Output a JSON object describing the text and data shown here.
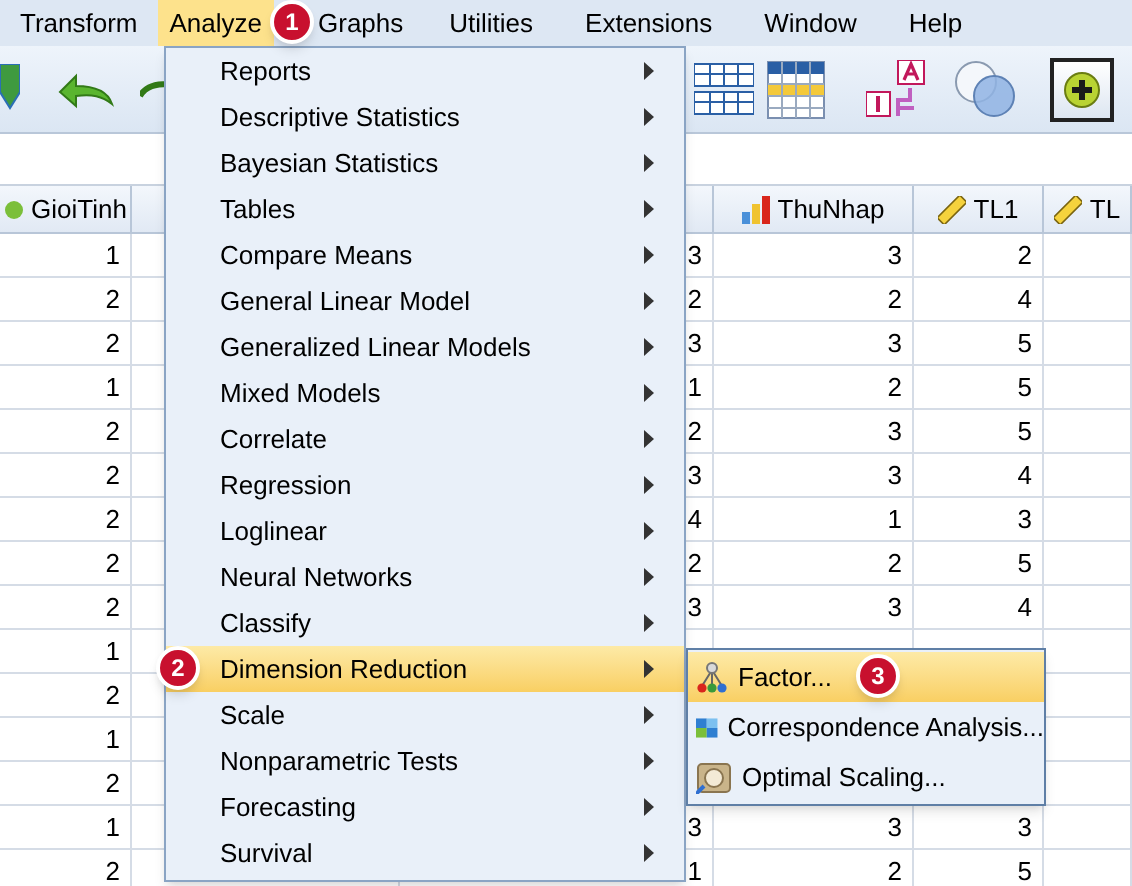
{
  "menubar": [
    {
      "label": "Transform",
      "selected": false
    },
    {
      "label": "Analyze",
      "selected": true,
      "badge": "1"
    },
    {
      "label": "Graphs",
      "selected": false
    },
    {
      "label": "Utilities",
      "selected": false
    },
    {
      "label": "Extensions",
      "selected": false
    },
    {
      "label": "Window",
      "selected": false
    },
    {
      "label": "Help",
      "selected": false
    }
  ],
  "grid": {
    "columns": [
      {
        "header": "GioiTinh",
        "kind": "nominal"
      },
      {
        "kind": "blank"
      },
      {
        "kind": "blank"
      },
      {
        "header": "ThuNhap",
        "kind": "ordinal"
      },
      {
        "header": "TL1",
        "kind": "scale"
      },
      {
        "header": "TL",
        "kind": "scale"
      }
    ],
    "rows": [
      [
        "1",
        null,
        "3",
        "3",
        "2",
        null
      ],
      [
        "2",
        null,
        "2",
        "2",
        "4",
        null
      ],
      [
        "2",
        null,
        "3",
        "3",
        "5",
        null
      ],
      [
        "1",
        null,
        "1",
        "2",
        "5",
        null
      ],
      [
        "2",
        null,
        "2",
        "3",
        "5",
        null
      ],
      [
        "2",
        null,
        "3",
        "3",
        "4",
        null
      ],
      [
        "2",
        null,
        "4",
        "1",
        "3",
        null
      ],
      [
        "2",
        null,
        "2",
        "2",
        "5",
        null
      ],
      [
        "2",
        null,
        "3",
        "3",
        "4",
        null
      ],
      [
        "1",
        null,
        null,
        null,
        null,
        null
      ],
      [
        "2",
        null,
        null,
        null,
        null,
        null
      ],
      [
        "1",
        null,
        null,
        null,
        null,
        null
      ],
      [
        "2",
        null,
        null,
        null,
        null,
        null
      ],
      [
        "1",
        null,
        "3",
        "3",
        "3",
        null
      ],
      [
        "2",
        null,
        "1",
        "2",
        "5",
        null
      ]
    ]
  },
  "analyze_menu": [
    {
      "label": "Reports",
      "selected": false
    },
    {
      "label": "Descriptive Statistics",
      "selected": false
    },
    {
      "label": "Bayesian Statistics",
      "selected": false
    },
    {
      "label": "Tables",
      "selected": false
    },
    {
      "label": "Compare Means",
      "selected": false
    },
    {
      "label": "General Linear Model",
      "selected": false
    },
    {
      "label": "Generalized Linear Models",
      "selected": false
    },
    {
      "label": "Mixed Models",
      "selected": false
    },
    {
      "label": "Correlate",
      "selected": false
    },
    {
      "label": "Regression",
      "selected": false
    },
    {
      "label": "Loglinear",
      "selected": false
    },
    {
      "label": "Neural Networks",
      "selected": false
    },
    {
      "label": "Classify",
      "selected": false
    },
    {
      "label": "Dimension Reduction",
      "selected": true,
      "badge": "2"
    },
    {
      "label": "Scale",
      "selected": false
    },
    {
      "label": "Nonparametric Tests",
      "selected": false
    },
    {
      "label": "Forecasting",
      "selected": false
    },
    {
      "label": "Survival",
      "selected": false
    }
  ],
  "submenu": [
    {
      "label": "Factor...",
      "kind": "factor",
      "selected": true,
      "badge": "3"
    },
    {
      "label": "Correspondence Analysis...",
      "kind": "correspondence",
      "selected": false
    },
    {
      "label": "Optimal Scaling...",
      "kind": "optimal",
      "selected": false
    }
  ]
}
